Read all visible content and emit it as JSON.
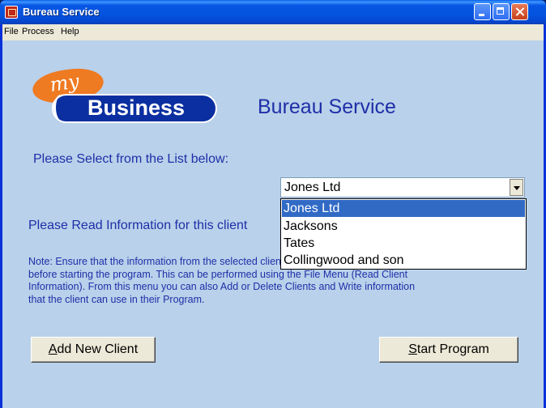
{
  "window": {
    "title": "Bureau Service",
    "icon": "app-icon"
  },
  "menu": {
    "items": [
      "File",
      "Process",
      "Help"
    ]
  },
  "logo": {
    "my": "my",
    "business": "Business"
  },
  "heading": "Bureau Service",
  "select_label": "Please Select from the List below:",
  "combo": {
    "selected": "Jones Ltd",
    "options": [
      "Jones Ltd",
      "Jacksons",
      "Tates",
      "Collingwood and son"
    ],
    "highlight_color": "#316ac5"
  },
  "info_label": "Please Read Information for this client",
  "note_lines": [
    "Note: Ensure that the information from the selected client has been read",
    "before starting the program. This can be performed using the File Menu (Read Client",
    "Information). From this menu you can also Add or Delete Clients and Write information",
    "that the client can use in their Program."
  ],
  "buttons": {
    "add_accel": "A",
    "add_rest": "dd New Client",
    "start_accel": "S",
    "start_rest": "tart Program"
  },
  "colors": {
    "client_bg": "#b9d1ea",
    "text_blue": "#1f2fa8",
    "logo_orange": "#ee7a22",
    "logo_navy": "#0b2fa0"
  }
}
